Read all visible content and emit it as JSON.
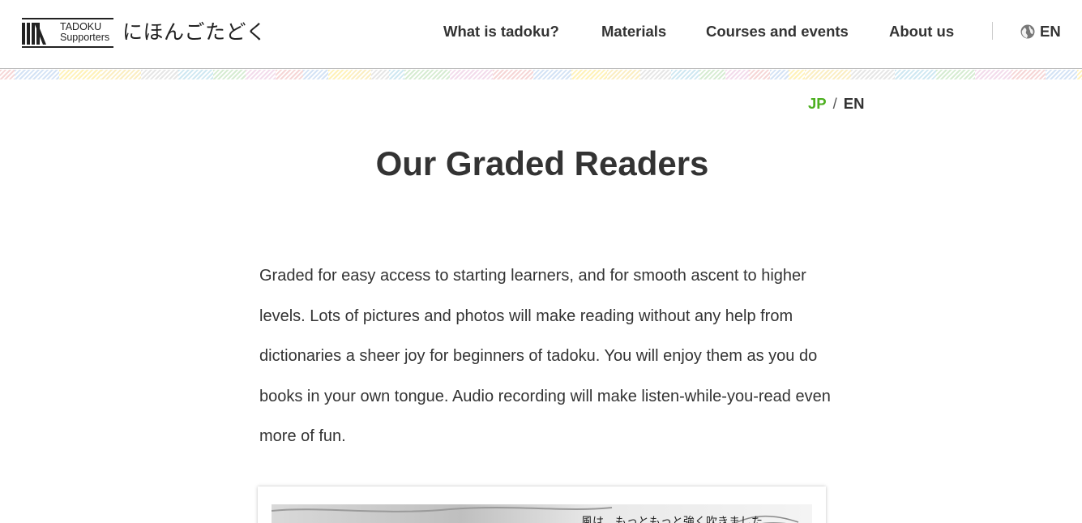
{
  "header": {
    "logo": {
      "en_line1": "TADOKU",
      "en_line2": "Supporters",
      "jp": "にほんごたどく"
    },
    "nav": [
      {
        "label": "What is tadoku?"
      },
      {
        "label": "Materials"
      },
      {
        "label": "Courses and events"
      },
      {
        "label": "About us"
      }
    ],
    "language": {
      "icon": "globe-icon",
      "label": "EN"
    }
  },
  "lang_switch": {
    "jp": "JP",
    "separator": "/",
    "en": "EN",
    "active": "JP",
    "active_color": "#4caf1f"
  },
  "page": {
    "title": "Our Graded Readers",
    "intro": "Graded for easy access to starting learners, and for smooth ascent to higher levels. Lots of pictures and photos will make reading without any help from dictionaries a sheer joy for beginners of tadoku. You will enjoy them as you do books in your own tongue. Audio recording will make listen-while-you-read even more of fun."
  },
  "colors": {
    "text": "#333333",
    "accent": "#4caf1f",
    "border": "#bdbdbd"
  }
}
